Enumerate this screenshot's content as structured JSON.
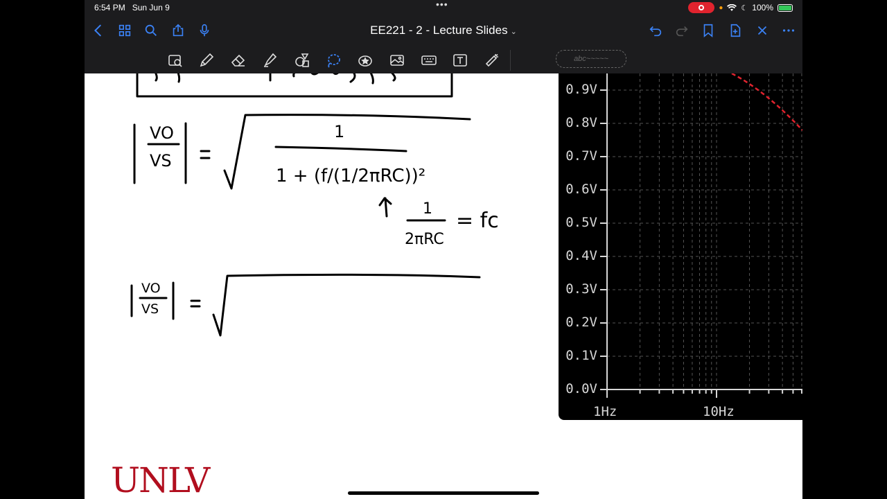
{
  "status_bar": {
    "time": "6:54 PM",
    "date": "Sun Jun 9",
    "battery_percent": "100%"
  },
  "nav": {
    "title": "EE221 - 2 - Lecture Slides",
    "title_chevron": "⌄",
    "icons": [
      "back-chevron-icon",
      "grid-icon",
      "search-icon",
      "share-icon",
      "microphone-icon",
      "undo-icon",
      "redo-icon",
      "bookmark-icon",
      "add-page-icon",
      "close-icon",
      "more-icon"
    ]
  },
  "toolbar": {
    "tools": [
      "zoom-window-tool",
      "pen-tool",
      "eraser-tool",
      "highlighter-tool",
      "shapes-tool",
      "lasso-tool",
      "sticker-tool",
      "image-tool",
      "keyboard-tool",
      "text-tool",
      "laser-pointer-tool"
    ],
    "pill_text": "abc~~~~~",
    "accent": "#3b82f6"
  },
  "plot": {
    "y_ticks": [
      "0.9V",
      "0.8V",
      "0.7V",
      "0.6V",
      "0.5V",
      "0.4V",
      "0.3V",
      "0.2V",
      "0.1V",
      "0.0V"
    ],
    "x_ticks": [
      "1Hz",
      "10Hz"
    ],
    "grid": "dashed",
    "trace_color": "#e0232e",
    "background": "#000000"
  },
  "notes": {
    "eq1_lhs_num": "VO",
    "eq1_lhs_den": "VS",
    "eq1_frac_num": "1",
    "eq1_frac_den": "1 + (f/(1/2πRC))²",
    "fc_num": "1",
    "fc_den": "2πRC",
    "fc_label": "= fc",
    "eq2_lhs_num": "VO",
    "eq2_lhs_den": "VS"
  },
  "footer": {
    "logo_text": "UNLV",
    "brand_color": "#b10e1e"
  }
}
